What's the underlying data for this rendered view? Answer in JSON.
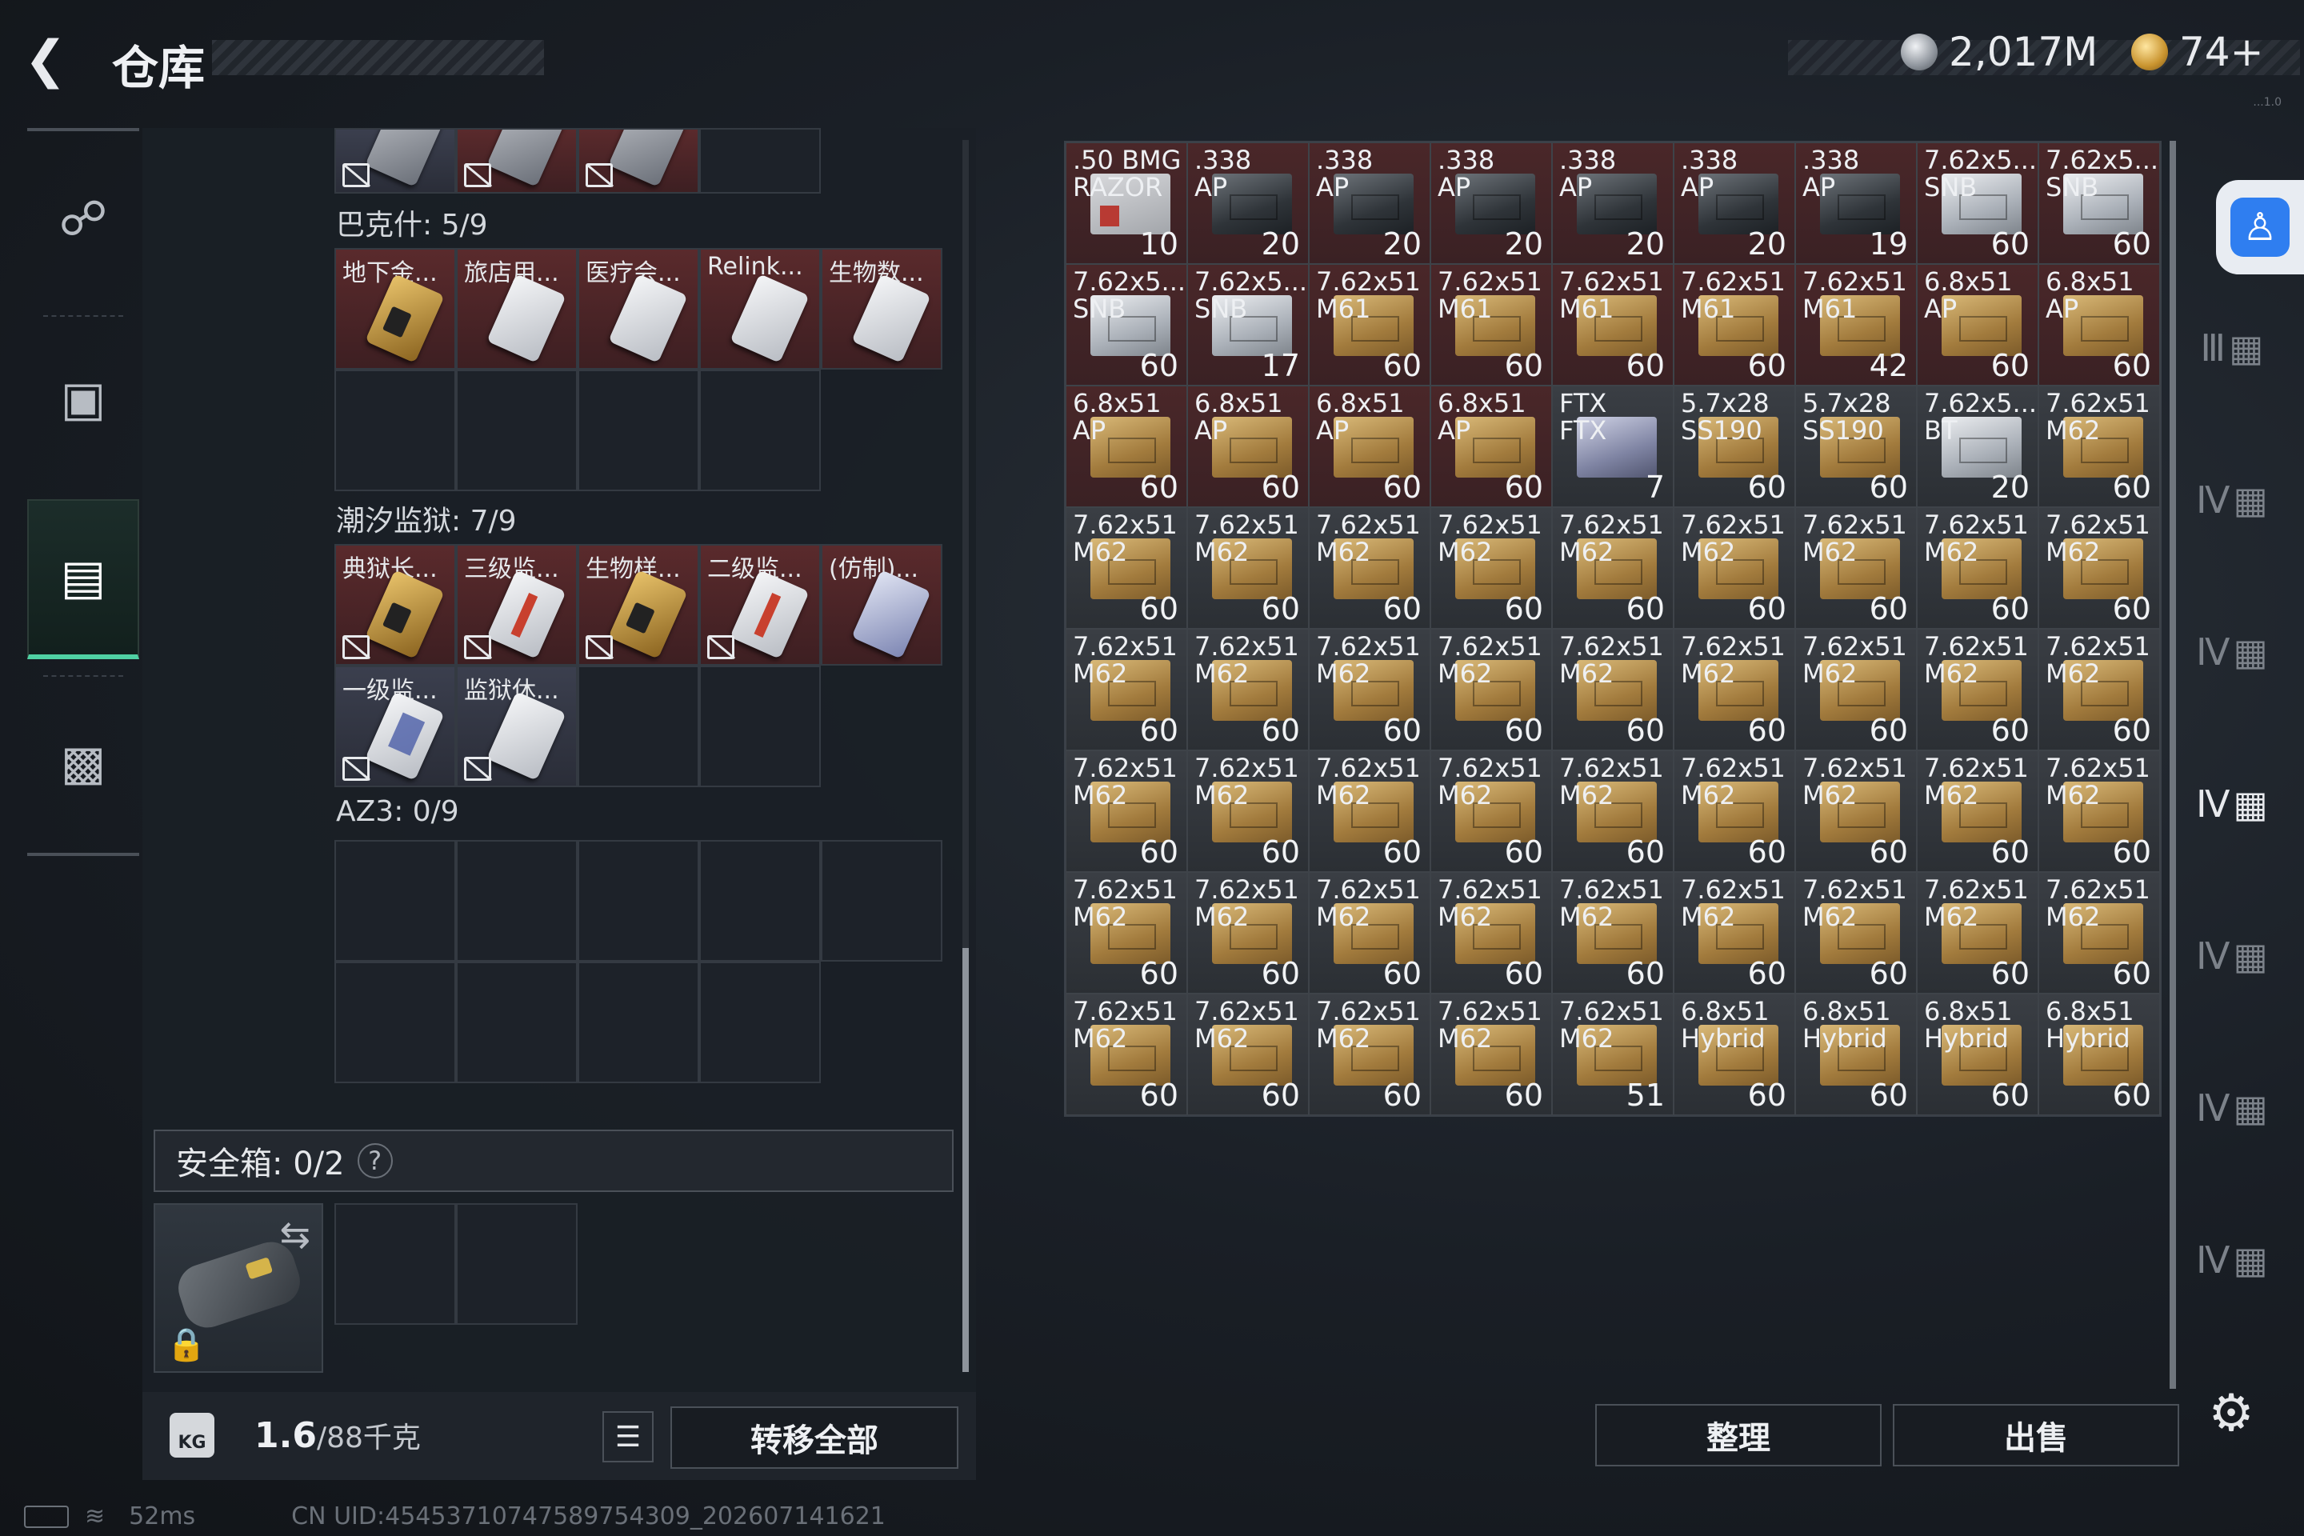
{
  "header": {
    "title": "仓库",
    "silver": "2,017M",
    "gold": "74+",
    "version": "...1.0"
  },
  "nav": [
    {
      "name": "weapon",
      "icon": "gun-icon"
    },
    {
      "name": "gear",
      "icon": "backpack-icon"
    },
    {
      "name": "storage",
      "icon": "container-icon"
    },
    {
      "name": "case",
      "icon": "briefcase-icon"
    }
  ],
  "left": {
    "top_row": [
      "",
      "",
      "",
      ""
    ],
    "bakesh": {
      "title": "巴克什: 5/9",
      "items": [
        "地下金...",
        "旅店用...",
        "医疗会...",
        "Relink...",
        "生物数..."
      ]
    },
    "prison": {
      "title": "潮汐监狱: 7/9",
      "items": [
        "典狱长...",
        "三级监...",
        "生物样...",
        "二级监...",
        "(仿制)...",
        "一级监...",
        "监狱休..."
      ]
    },
    "az3": {
      "title": "AZ3: 0/9"
    },
    "safe": {
      "label": "安全箱: 0/2",
      "help": "?"
    },
    "weight": {
      "current": "1.6",
      "max": "/88千克",
      "kg": "KG"
    },
    "transfer_label": "转移全部"
  },
  "status": {
    "ping": "52ms",
    "uid": "CN UID:4545371074758975430​9_202607141621"
  },
  "right": {
    "slots": [
      {
        "name": ".50 BMG\nRAZOR",
        "qty": "10",
        "style": "redb",
        "bg": "t-red"
      },
      {
        "name": ".338\nAP",
        "qty": "20",
        "style": "dark",
        "bg": "t-red"
      },
      {
        "name": ".338\nAP",
        "qty": "20",
        "style": "dark",
        "bg": "t-red"
      },
      {
        "name": ".338\nAP",
        "qty": "20",
        "style": "dark",
        "bg": "t-red"
      },
      {
        "name": ".338\nAP",
        "qty": "20",
        "style": "dark",
        "bg": "t-red"
      },
      {
        "name": ".338\nAP",
        "qty": "20",
        "style": "dark",
        "bg": "t-red"
      },
      {
        "name": ".338\nAP",
        "qty": "19",
        "style": "dark",
        "bg": "t-red"
      },
      {
        "name": "7.62x5...\nSNB",
        "qty": "60",
        "style": "white",
        "bg": "t-red"
      },
      {
        "name": "7.62x5...\nSNB",
        "qty": "60",
        "style": "white",
        "bg": "t-red"
      },
      {
        "name": "7.62x5...\nSNB",
        "qty": "60",
        "style": "white",
        "bg": "t-red"
      },
      {
        "name": "7.62x5...\nSNB",
        "qty": "17",
        "style": "white",
        "bg": "t-red"
      },
      {
        "name": "7.62x51\nM61",
        "qty": "60",
        "style": "tan",
        "bg": "t-red"
      },
      {
        "name": "7.62x51\nM61",
        "qty": "60",
        "style": "tan",
        "bg": "t-red"
      },
      {
        "name": "7.62x51\nM61",
        "qty": "60",
        "style": "tan",
        "bg": "t-red"
      },
      {
        "name": "7.62x51\nM61",
        "qty": "60",
        "style": "tan",
        "bg": "t-red"
      },
      {
        "name": "7.62x51\nM61",
        "qty": "42",
        "style": "tan",
        "bg": "t-red"
      },
      {
        "name": "6.8x51\nAP",
        "qty": "60",
        "style": "tan",
        "bg": "t-red"
      },
      {
        "name": "6.8x51\nAP",
        "qty": "60",
        "style": "tan",
        "bg": "t-red"
      },
      {
        "name": "6.8x51\nAP",
        "qty": "60",
        "style": "tan",
        "bg": "t-red"
      },
      {
        "name": "6.8x51\nAP",
        "qty": "60",
        "style": "tan",
        "bg": "t-red"
      },
      {
        "name": "6.8x51\nAP",
        "qty": "60",
        "style": "tan",
        "bg": "t-red"
      },
      {
        "name": "6.8x51\nAP",
        "qty": "60",
        "style": "tan",
        "bg": "t-red"
      },
      {
        "name": "FTX\nFTX",
        "qty": "7",
        "style": "lilac",
        "bg": "t-gray"
      },
      {
        "name": "5.7x28\nSS190",
        "qty": "60",
        "style": "tan",
        "bg": "t-gray"
      },
      {
        "name": "5.7x28\nSS190",
        "qty": "60",
        "style": "tan",
        "bg": "t-gray"
      },
      {
        "name": "7.62x5...\nBT",
        "qty": "20",
        "style": "white",
        "bg": "t-gray"
      },
      {
        "name": "7.62x51\nM62",
        "qty": "60",
        "style": "tan",
        "bg": "t-gray"
      },
      {
        "name": "7.62x51\nM62",
        "qty": "60",
        "style": "tan",
        "bg": "t-gray"
      },
      {
        "name": "7.62x51\nM62",
        "qty": "60",
        "style": "tan",
        "bg": "t-gray"
      },
      {
        "name": "7.62x51\nM62",
        "qty": "60",
        "style": "tan",
        "bg": "t-gray"
      },
      {
        "name": "7.62x51\nM62",
        "qty": "60",
        "style": "tan",
        "bg": "t-gray"
      },
      {
        "name": "7.62x51\nM62",
        "qty": "60",
        "style": "tan",
        "bg": "t-gray"
      },
      {
        "name": "7.62x51\nM62",
        "qty": "60",
        "style": "tan",
        "bg": "t-gray"
      },
      {
        "name": "7.62x51\nM62",
        "qty": "60",
        "style": "tan",
        "bg": "t-gray"
      },
      {
        "name": "7.62x51\nM62",
        "qty": "60",
        "style": "tan",
        "bg": "t-gray"
      },
      {
        "name": "7.62x51\nM62",
        "qty": "60",
        "style": "tan",
        "bg": "t-gray"
      },
      {
        "name": "7.62x51\nM62",
        "qty": "60",
        "style": "tan",
        "bg": "t-gray"
      },
      {
        "name": "7.62x51\nM62",
        "qty": "60",
        "style": "tan",
        "bg": "t-gray"
      },
      {
        "name": "7.62x51\nM62",
        "qty": "60",
        "style": "tan",
        "bg": "t-gray"
      },
      {
        "name": "7.62x51\nM62",
        "qty": "60",
        "style": "tan",
        "bg": "t-gray"
      },
      {
        "name": "7.62x51\nM62",
        "qty": "60",
        "style": "tan",
        "bg": "t-gray"
      },
      {
        "name": "7.62x51\nM62",
        "qty": "60",
        "style": "tan",
        "bg": "t-gray"
      },
      {
        "name": "7.62x51\nM62",
        "qty": "60",
        "style": "tan",
        "bg": "t-gray"
      },
      {
        "name": "7.62x51\nM62",
        "qty": "60",
        "style": "tan",
        "bg": "t-gray"
      },
      {
        "name": "7.62x51\nM62",
        "qty": "60",
        "style": "tan",
        "bg": "t-gray"
      },
      {
        "name": "7.62x51\nM62",
        "qty": "60",
        "style": "tan",
        "bg": "t-gray"
      },
      {
        "name": "7.62x51\nM62",
        "qty": "60",
        "style": "tan",
        "bg": "t-gray"
      },
      {
        "name": "7.62x51\nM62",
        "qty": "60",
        "style": "tan",
        "bg": "t-gray"
      },
      {
        "name": "7.62x51\nM62",
        "qty": "60",
        "style": "tan",
        "bg": "t-gray"
      },
      {
        "name": "7.62x51\nM62",
        "qty": "60",
        "style": "tan",
        "bg": "t-gray"
      },
      {
        "name": "7.62x51\nM62",
        "qty": "60",
        "style": "tan",
        "bg": "t-gray"
      },
      {
        "name": "7.62x51\nM62",
        "qty": "60",
        "style": "tan",
        "bg": "t-gray"
      },
      {
        "name": "7.62x51\nM62",
        "qty": "60",
        "style": "tan",
        "bg": "t-gray"
      },
      {
        "name": "7.62x51\nM62",
        "qty": "60",
        "style": "tan",
        "bg": "t-gray"
      },
      {
        "name": "7.62x51\nM62",
        "qty": "60",
        "style": "tan",
        "bg": "t-gray"
      },
      {
        "name": "7.62x51\nM62",
        "qty": "60",
        "style": "tan",
        "bg": "t-gray"
      },
      {
        "name": "7.62x51\nM62",
        "qty": "60",
        "style": "tan",
        "bg": "t-gray"
      },
      {
        "name": "7.62x51\nM62",
        "qty": "60",
        "style": "tan",
        "bg": "t-gray"
      },
      {
        "name": "7.62x51\nM62",
        "qty": "60",
        "style": "tan",
        "bg": "t-gray"
      },
      {
        "name": "7.62x51\nM62",
        "qty": "60",
        "style": "tan",
        "bg": "t-gray"
      },
      {
        "name": "7.62x51\nM62",
        "qty": "60",
        "style": "tan",
        "bg": "t-gray"
      },
      {
        "name": "7.62x51\nM62",
        "qty": "60",
        "style": "tan",
        "bg": "t-gray"
      },
      {
        "name": "7.62x51\nM62",
        "qty": "60",
        "style": "tan",
        "bg": "t-gray"
      },
      {
        "name": "7.62x51\nM62",
        "qty": "60",
        "style": "tan",
        "bg": "t-gray"
      },
      {
        "name": "7.62x51\nM62",
        "qty": "60",
        "style": "tan",
        "bg": "t-gray"
      },
      {
        "name": "7.62x51\nM62",
        "qty": "60",
        "style": "tan",
        "bg": "t-gray"
      },
      {
        "name": "7.62x51\nM62",
        "qty": "60",
        "style": "tan",
        "bg": "t-gray"
      },
      {
        "name": "7.62x51\nM62",
        "qty": "51",
        "style": "tan",
        "bg": "t-gray"
      },
      {
        "name": "6.8x51\nHybrid",
        "qty": "60",
        "style": "tan",
        "bg": "t-gray"
      },
      {
        "name": "6.8x51\nHybrid",
        "qty": "60",
        "style": "tan",
        "bg": "t-gray"
      },
      {
        "name": "6.8x51\nHybrid",
        "qty": "60",
        "style": "tan",
        "bg": "t-gray"
      },
      {
        "name": "6.8x51\nHybrid",
        "qty": "60",
        "style": "tan",
        "bg": "t-gray"
      }
    ],
    "sort_label": "整理",
    "sell_label": "出售"
  },
  "rside": [
    "Ⅲ",
    "Ⅳ",
    "Ⅳ",
    "Ⅳ",
    "Ⅳ",
    "Ⅳ",
    "Ⅳ"
  ]
}
